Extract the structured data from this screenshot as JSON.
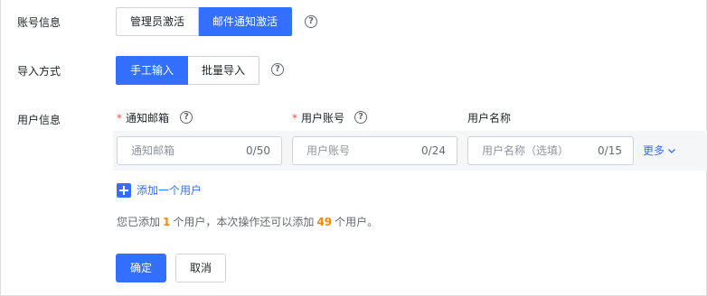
{
  "account": {
    "label": "账号信息",
    "options": [
      "管理员激活",
      "邮件通知激活"
    ],
    "selected": "邮件通知激活"
  },
  "import": {
    "label": "导入方式",
    "options": [
      "手工输入",
      "批量导入"
    ],
    "selected": "手工输入"
  },
  "users": {
    "label": "用户信息",
    "columns": {
      "email": "通知邮箱",
      "account": "用户账号",
      "name": "用户名称"
    },
    "required_mark": "*",
    "fields": {
      "email_placeholder": "通知邮箱",
      "email_count": "0/50",
      "account_placeholder": "用户账号",
      "account_count": "0/24",
      "name_placeholder": "用户名称（选填）",
      "name_count": "0/15"
    },
    "more_label": "更多",
    "add_label": "添加一个用户"
  },
  "summary": {
    "prefix": "您已添加",
    "added": "1",
    "middle": "个用户，本次操作还可以添加",
    "remaining": "49",
    "suffix": "个用户。"
  },
  "actions": {
    "confirm": "确定",
    "cancel": "取消"
  },
  "colors": {
    "accent": "#3370ff",
    "highlight": "#ff8800",
    "required": "#f54a45"
  }
}
